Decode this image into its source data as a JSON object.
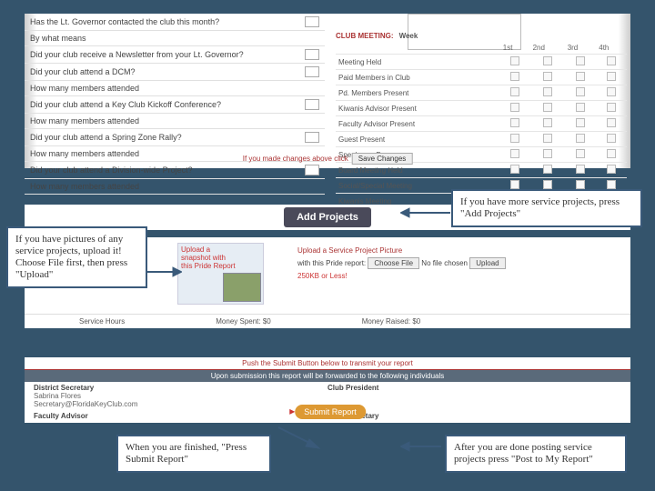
{
  "q": {
    "lt": "Has the Lt. Governor contacted the club this month?",
    "means": "By what means",
    "news": "Did your club receive a Newsletter from your Lt. Governor?",
    "dcm": "Did your club attend a DCM?",
    "m1": "How many members attended",
    "kick": "Did your club attend a Key Club Kickoff Conference?",
    "m2": "How many members attended",
    "zone": "Did your club attend a Spring Zone Rally?",
    "m3": "How many members attended",
    "div": "Did your club attend a Division-wide Project?",
    "m4": "How many members attended"
  },
  "grid": {
    "title": "CLUB MEETING:",
    "week": "Week",
    "cols": [
      "1st",
      "2nd",
      "3rd",
      "4th"
    ],
    "rows": [
      "Meeting Held",
      "Paid Members in Club",
      "Pd. Members Present",
      "Kiwanis Advisor Present",
      "Faculty Advisor Present",
      "Guest Present",
      "Speaker or Program",
      "Board Meeting Held",
      "Social/Special Meeting",
      "Kiwanis Meeting"
    ]
  },
  "save": {
    "msg": "If you made changes above click",
    "btn": "Save Changes"
  },
  "add": {
    "btn": "Add Projects"
  },
  "upload": {
    "bannerTitle": "Upload a snapshot with this Pride Report",
    "title": "Upload a Service Project Picture",
    "with": "with this Pride report:",
    "choose": "Choose File",
    "nofile": "No file chosen",
    "up": "Upload",
    "limit": "250KB or Less!"
  },
  "stats": {
    "hours": "Service Hours",
    "spent": "Money Spent: $0",
    "raised": "Money Raised: $0"
  },
  "submit": {
    "warn": "Push the Submit Button below to transmit your report",
    "bar": "Upon submission this report will be forwarded to the following individuals",
    "ds": "District Secretary",
    "dsv": "Sabrina Flores",
    "dse": "Secretary@FloridaKeyClub.com",
    "fa": "Faculty Advisor",
    "cp": "Club President",
    "cs": "Club Secretary",
    "btn": "Submit Report"
  },
  "call": {
    "c1": "If you have more service projects, press \"Add Projects\"",
    "c2": "If you have pictures of any service projects, upload it! Choose File first, then press \"Upload\"",
    "c3": "When you are finished, \"Press Submit Report\"",
    "c4": "After you are done posting service projects press \"Post to My Report\""
  }
}
